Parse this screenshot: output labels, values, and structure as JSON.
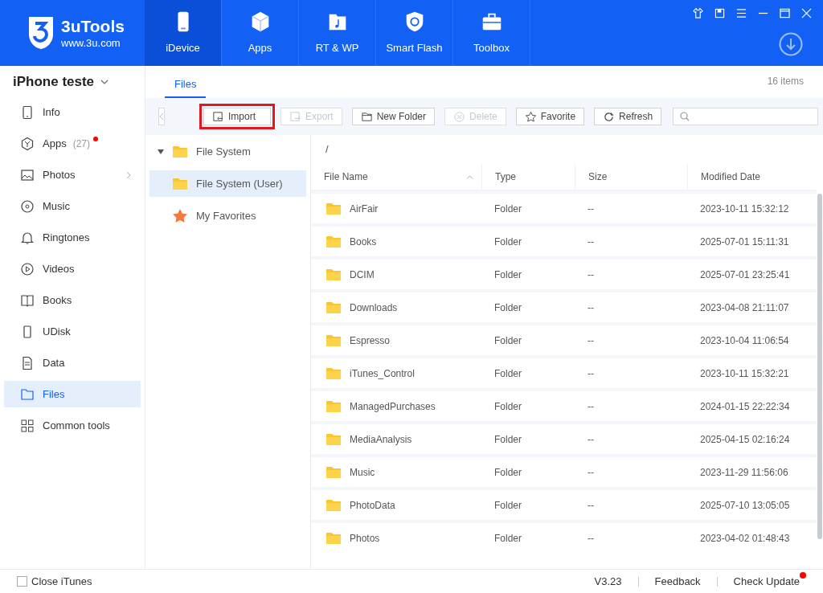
{
  "app": {
    "name": "3uTools",
    "site": "www.3u.com"
  },
  "nav_tabs": [
    {
      "label": "iDevice",
      "kind": "phone",
      "selected": true
    },
    {
      "label": "Apps",
      "kind": "cube",
      "selected": false
    },
    {
      "label": "RT & WP",
      "kind": "music",
      "selected": false
    },
    {
      "label": "Smart Flash",
      "kind": "shield",
      "selected": false
    },
    {
      "label": "Toolbox",
      "kind": "toolbox",
      "selected": false
    }
  ],
  "device": {
    "name": "iPhone teste"
  },
  "sidebar": {
    "items": [
      {
        "label": "Info",
        "kind": "phone",
        "selected": false
      },
      {
        "label": "Apps",
        "count": "(27)",
        "badge": true,
        "kind": "apps",
        "selected": false
      },
      {
        "label": "Photos",
        "chevron": true,
        "kind": "photo",
        "selected": false
      },
      {
        "label": "Music",
        "kind": "music",
        "selected": false
      },
      {
        "label": "Ringtones",
        "kind": "bell",
        "selected": false
      },
      {
        "label": "Videos",
        "kind": "play",
        "selected": false
      },
      {
        "label": "Books",
        "kind": "book",
        "selected": false
      },
      {
        "label": "UDisk",
        "kind": "disk",
        "selected": false
      },
      {
        "label": "Data",
        "kind": "doc",
        "selected": false
      },
      {
        "label": "Files",
        "kind": "folder",
        "selected": true
      },
      {
        "label": "Common tools",
        "kind": "grid",
        "selected": false
      }
    ]
  },
  "content_tabs": [
    {
      "label": "Files",
      "selected": true
    }
  ],
  "item_count": "16 items",
  "toolbar": [
    {
      "label": "Import",
      "kind": "import",
      "disabled": false,
      "highlighted": true
    },
    {
      "label": "Export",
      "kind": "export",
      "disabled": true,
      "highlighted": false
    },
    {
      "label": "New Folder",
      "kind": "folder",
      "disabled": false,
      "highlighted": false
    },
    {
      "label": "Delete",
      "kind": "delete",
      "disabled": true,
      "highlighted": false
    },
    {
      "label": "Favorite",
      "kind": "star",
      "disabled": false,
      "highlighted": false
    },
    {
      "label": "Refresh",
      "kind": "refresh",
      "disabled": false,
      "highlighted": false
    }
  ],
  "tree": [
    {
      "label": "File System",
      "kind": "folder",
      "expanded": true,
      "selected": false
    },
    {
      "label": "File System (User)",
      "kind": "folder",
      "selected": true
    },
    {
      "label": "My Favorites",
      "kind": "star",
      "selected": false
    }
  ],
  "path": "/",
  "table": {
    "columns": [
      "File Name",
      "Type",
      "Size",
      "Modified Date"
    ],
    "rows": [
      [
        "AirFair",
        "Folder",
        "--",
        "2023-10-11 15:32:12"
      ],
      [
        "Books",
        "Folder",
        "--",
        "2025-07-01 15:11:31"
      ],
      [
        "DCIM",
        "Folder",
        "--",
        "2025-07-01 23:25:41"
      ],
      [
        "Downloads",
        "Folder",
        "--",
        "2023-04-08 21:11:07"
      ],
      [
        "Espresso",
        "Folder",
        "--",
        "2023-10-04 11:06:54"
      ],
      [
        "iTunes_Control",
        "Folder",
        "--",
        "2023-10-11 15:32:21"
      ],
      [
        "ManagedPurchases",
        "Folder",
        "--",
        "2024-01-15 22:22:34"
      ],
      [
        "MediaAnalysis",
        "Folder",
        "--",
        "2025-04-15 02:16:24"
      ],
      [
        "Music",
        "Folder",
        "--",
        "2023-11-29 11:56:06"
      ],
      [
        "PhotoData",
        "Folder",
        "--",
        "2025-07-10 13:05:05"
      ],
      [
        "Photos",
        "Folder",
        "--",
        "2023-04-02 01:48:43"
      ]
    ]
  },
  "status_bar": {
    "close_itunes": {
      "label": "Close iTunes",
      "checked": false
    },
    "version": "V3.23",
    "feedback": "Feedback",
    "check_update": "Check Update",
    "update_badge": true
  }
}
